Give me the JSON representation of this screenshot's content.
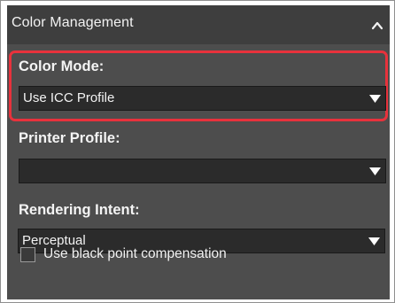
{
  "panel": {
    "title": "Color Management",
    "collapse_icon": "chevron-up-icon"
  },
  "color_mode": {
    "label": "Color Mode:",
    "value": "Use ICC Profile",
    "highlight_color": "#e8323c"
  },
  "printer_profile": {
    "label": "Printer Profile:",
    "value": ""
  },
  "rendering_intent": {
    "label": "Rendering Intent:",
    "value": "Perceptual"
  },
  "black_point": {
    "label": "Use black point compensation",
    "checked": false
  },
  "dropdown_icon": "triangle-down-icon"
}
